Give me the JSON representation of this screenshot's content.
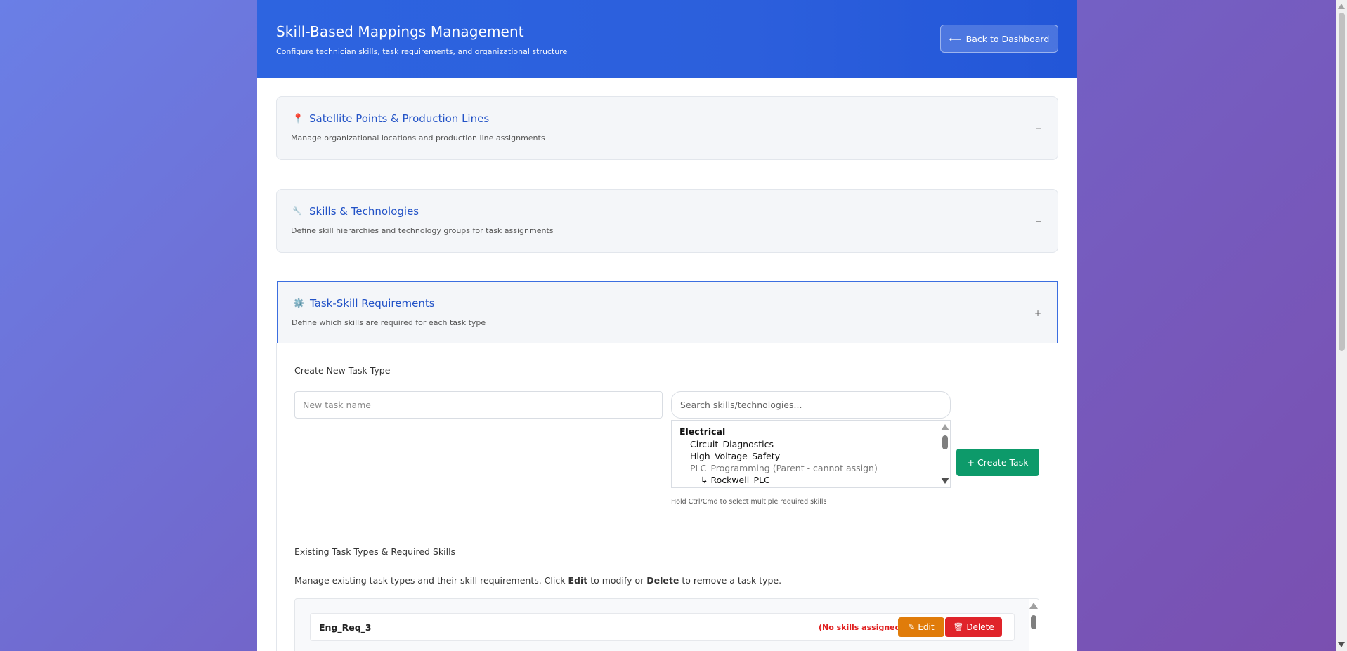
{
  "header": {
    "title": "Skill-Based Mappings Management",
    "subtitle": "Configure technician skills, task requirements, and organizational structure",
    "back_label": "Back to Dashboard"
  },
  "sections": [
    {
      "icon": "📍",
      "title": "Satellite Points & Production Lines",
      "desc": "Manage organizational locations and production line assignments",
      "toggle": "−"
    },
    {
      "icon": "🔧",
      "title": "Skills & Technologies",
      "desc": "Define skill hierarchies and technology groups for task assignments",
      "toggle": "−"
    },
    {
      "icon": "⚙️",
      "title": "Task-Skill Requirements",
      "desc": "Define which skills are required for each task type",
      "toggle": "+"
    }
  ],
  "create": {
    "title": "Create New Task Type",
    "task_placeholder": "New task name",
    "search_placeholder": "Search skills/technologies...",
    "skill_group": "Electrical",
    "skill_options": [
      "Circuit_Diagnostics",
      "High_Voltage_Safety",
      "PLC_Programming (Parent - cannot assign)",
      "↳ Rockwell_PLC"
    ],
    "hint": "Hold Ctrl/Cmd to select multiple required skills",
    "create_label": "+ Create Task"
  },
  "existing": {
    "title": "Existing Task Types & Required Skills",
    "desc_prefix": "Manage existing task types and their skill requirements. Click ",
    "desc_edit": "Edit",
    "desc_mid": " to modify or ",
    "desc_delete": "Delete",
    "desc_suffix": " to remove a task type.",
    "tasks": [
      {
        "name": "Eng_Req_3",
        "status": "(No skills assigned)",
        "edit_label": "Edit",
        "delete_label": "Delete"
      }
    ]
  },
  "colors": {
    "header": "#2c5fdc",
    "accent": "#2353c7",
    "create": "#0d9a6a",
    "edit": "#e07c0a",
    "delete": "#e0242a",
    "warning": "#e01e1e"
  }
}
